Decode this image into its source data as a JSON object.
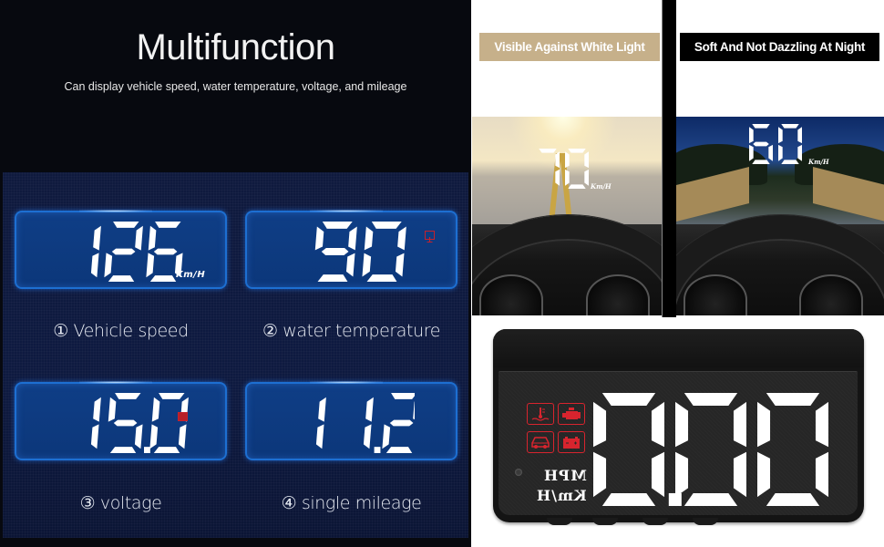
{
  "left_panel": {
    "title": "Multifunction",
    "subtitle": "Can display vehicle speed, water temperature, voltage, and mileage",
    "displays": [
      {
        "id": "speed",
        "value": "126",
        "unit": "Km/H",
        "indicator": null,
        "label": "① Vehicle speed"
      },
      {
        "id": "water-temp",
        "value": "90",
        "unit": null,
        "indicator": "thermometer-icon",
        "label": "② water temperature"
      },
      {
        "id": "voltage",
        "value": "15.0",
        "unit": null,
        "indicator": "battery-icon",
        "label": "③ voltage"
      },
      {
        "id": "mileage",
        "value": "11.2",
        "unit": null,
        "indicator": null,
        "label": "④ single mileage"
      }
    ],
    "colors": {
      "panel_border": "#1d6fd2",
      "panel_fill": "#0f3e86",
      "warning_red": "#c4222c",
      "background": "#0e1a40"
    }
  },
  "day_scene": {
    "caption": "Visible Against White Light",
    "caption_bg": "#c6b08a",
    "hud_speed": "70",
    "hud_unit": "Km/H"
  },
  "night_scene": {
    "caption": "Soft And Not Dazzling At Night",
    "caption_bg": "#000000",
    "hud_speed": "60",
    "hud_unit": "Km/H"
  },
  "device": {
    "display_value": "0.00",
    "unit_mph": "MPH",
    "unit_kmh": "Km/H",
    "warning_icons": [
      "coolant-temperature-icon",
      "check-engine-icon",
      "car-door-icon",
      "battery-icon"
    ],
    "warning_color": "#d8242e"
  }
}
